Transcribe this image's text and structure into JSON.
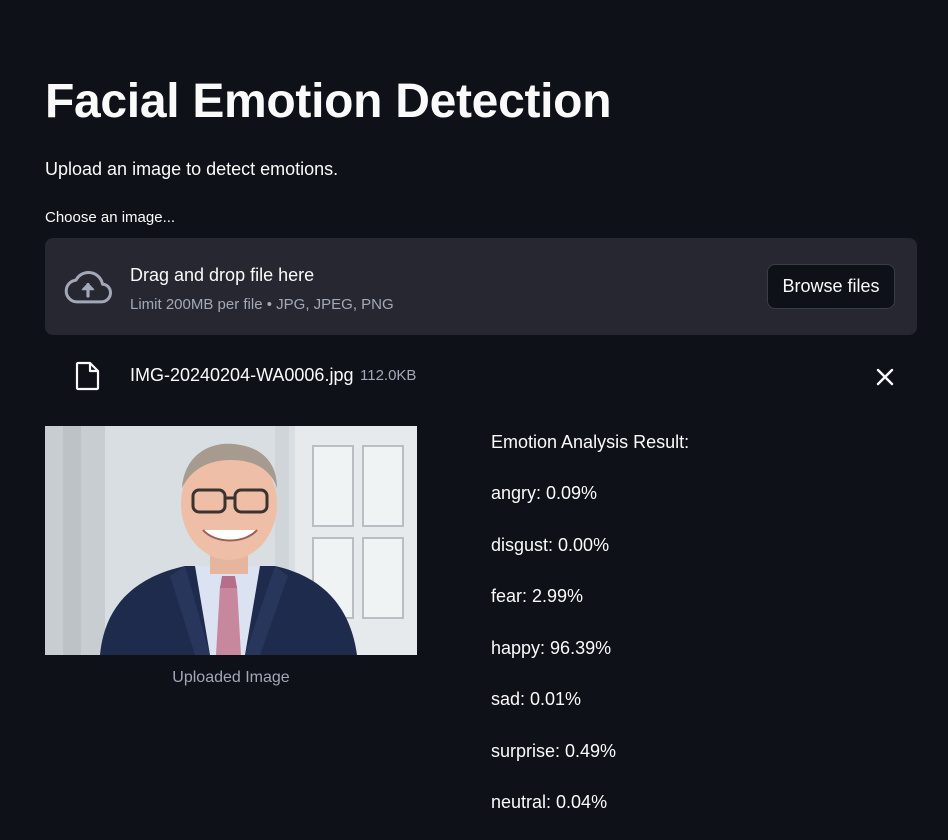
{
  "page": {
    "title": "Facial Emotion Detection",
    "subtitle": "Upload an image to detect emotions."
  },
  "uploader": {
    "label": "Choose an image...",
    "drop_text": "Drag and drop file here",
    "limit_text": "Limit 200MB per file • JPG, JPEG, PNG",
    "browse_label": "Browse files",
    "icon": "cloud-upload-icon"
  },
  "file": {
    "name": "IMG-20240204-WA0006.jpg",
    "size": "112.0KB",
    "icon": "file-icon",
    "remove_icon": "close-icon"
  },
  "image": {
    "caption": "Uploaded Image"
  },
  "results": {
    "heading": "Emotion Analysis Result:",
    "items": [
      {
        "label": "angry: 0.09%"
      },
      {
        "label": "disgust: 0.00%"
      },
      {
        "label": "fear: 2.99%"
      },
      {
        "label": "happy: 96.39%"
      },
      {
        "label": "sad: 0.01%"
      },
      {
        "label": "surprise: 0.49%"
      },
      {
        "label": "neutral: 0.04%"
      }
    ]
  },
  "colors": {
    "background": "#0e1117",
    "panel": "#262730",
    "text": "#fafafa",
    "muted": "#a3a8b8"
  }
}
